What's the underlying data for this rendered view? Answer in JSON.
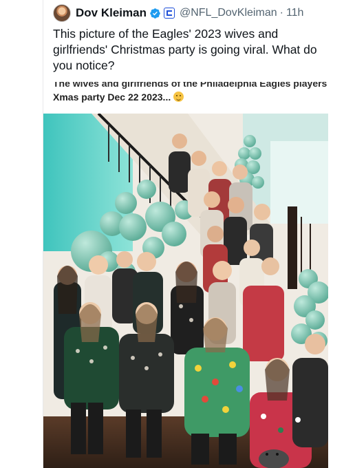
{
  "tweet": {
    "author_name": "Dov Kleiman",
    "handle": "@NFL_DovKleiman",
    "separator": "·",
    "time": "11h",
    "text": "This picture of the Eagles' 2023 wives and girlfriends' Christmas party is going viral. What do you notice?"
  },
  "media": {
    "caption_line1": "The wives and girlfriends of the Philadelphia Eagles players",
    "caption_line2": "Xmas party Dec 22 2023...",
    "caption_emoji": "grinning-face-icon"
  },
  "colors": {
    "verified_blue": "#1d9bf0",
    "handle_gray": "#536471",
    "balloon_teal": "#6fc2ae",
    "wall_cyan": "#62d3c9"
  }
}
